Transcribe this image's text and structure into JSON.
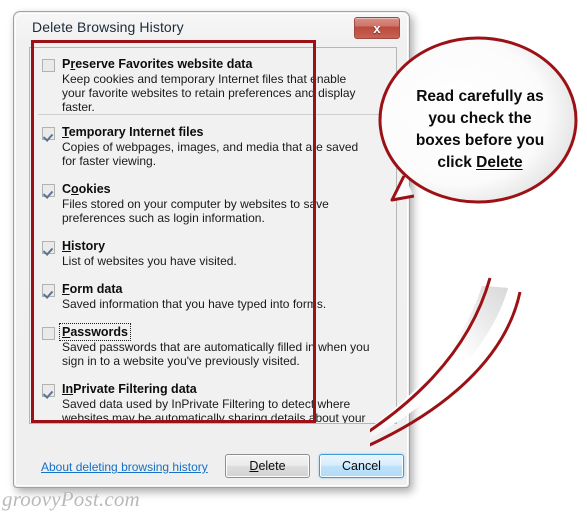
{
  "window": {
    "title": "Delete Browsing History",
    "close_label": "x"
  },
  "options": [
    {
      "label_pre": "P",
      "label_accel": "r",
      "label_post": "eserve Favorites website data",
      "checked": false,
      "focused": false,
      "description": "Keep cookies and temporary Internet files that enable your favorite websites to retain preferences and display faster."
    },
    {
      "label_pre": "",
      "label_accel": "T",
      "label_post": "emporary Internet files",
      "checked": true,
      "focused": false,
      "description": "Copies of webpages, images, and media that are saved for faster viewing."
    },
    {
      "label_pre": "C",
      "label_accel": "o",
      "label_post": "okies",
      "checked": true,
      "focused": false,
      "description": "Files stored on your computer by websites to save preferences such as login information."
    },
    {
      "label_pre": "",
      "label_accel": "H",
      "label_post": "istory",
      "checked": true,
      "focused": false,
      "description": "List of websites you have visited."
    },
    {
      "label_pre": "",
      "label_accel": "F",
      "label_post": "orm data",
      "checked": true,
      "focused": false,
      "description": "Saved information that you have typed into forms."
    },
    {
      "label_pre": "",
      "label_accel": "P",
      "label_post": "asswords",
      "checked": false,
      "focused": true,
      "description": "Saved passwords that are automatically filled in when you sign in to a website you've previously visited."
    },
    {
      "label_pre": "",
      "label_accel": "In",
      "label_post": "Private Filtering data",
      "checked": true,
      "focused": false,
      "description": "Saved data used by InPrivate Filtering to detect where websites may be automatically sharing details about your visit."
    }
  ],
  "footer": {
    "link_label": "About deleting browsing history",
    "delete_pre": "",
    "delete_accel": "D",
    "delete_post": "elete",
    "cancel_label": "Cancel"
  },
  "callout": {
    "line1": "Read carefully as",
    "line2": "you check the",
    "line3": "boxes before you",
    "line4_pre": "click ",
    "line4_underlined": "Delete"
  },
  "watermark": {
    "text": "groovyPost.com"
  },
  "colors": {
    "annotation_red": "#9b1115",
    "link_blue": "#1570c8",
    "close_red": "#b94a3c",
    "check_blue": "#5a7391"
  }
}
